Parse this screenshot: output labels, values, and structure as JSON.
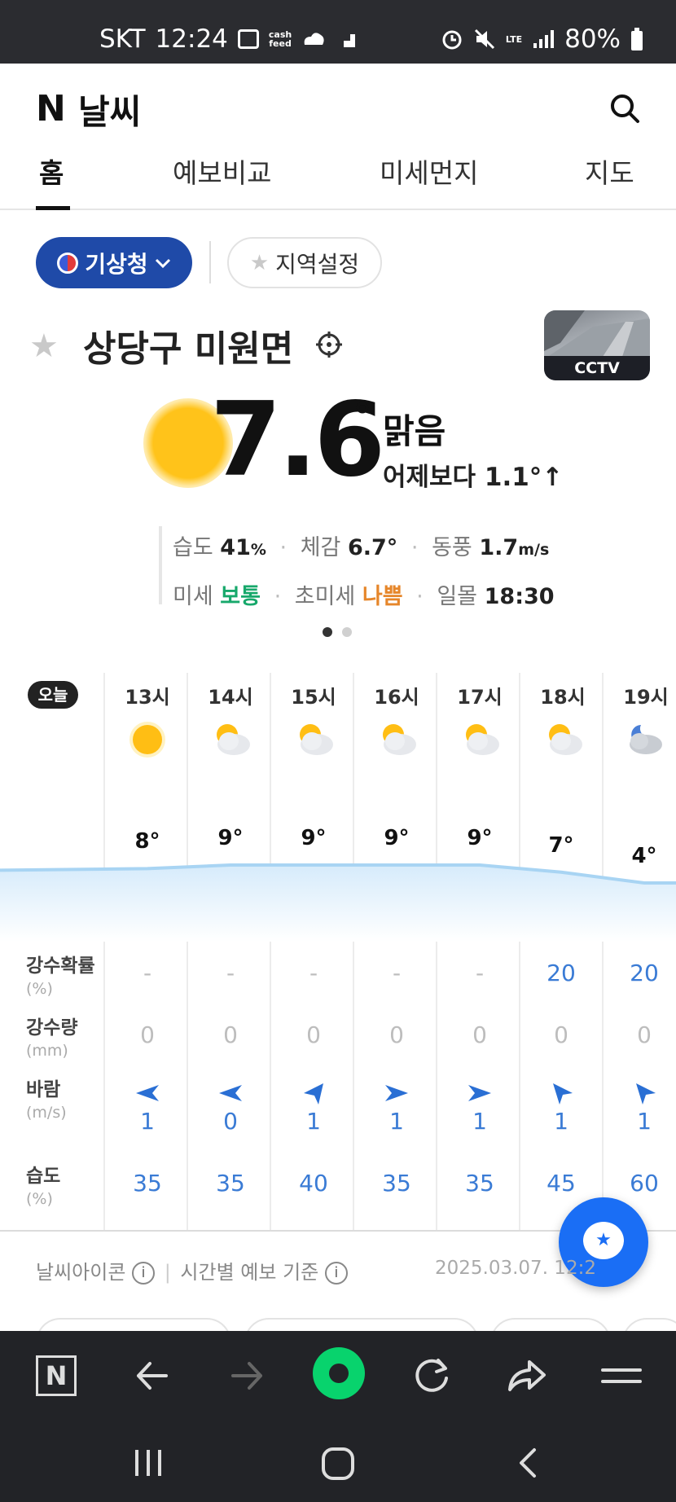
{
  "status_bar": {
    "carrier": "SKT",
    "time": "12:24",
    "cash_label_top": "cash",
    "cash_label_bottom": "feed",
    "network": "LTE",
    "battery": "80%"
  },
  "header": {
    "logo_n": "N",
    "title": "날씨",
    "tabs": [
      {
        "label": "홈",
        "active": true
      },
      {
        "label": "예보비교",
        "active": false
      },
      {
        "label": "미세먼지",
        "active": false
      },
      {
        "label": "지도",
        "active": false
      }
    ]
  },
  "source": {
    "provider": "기상청",
    "region_button": "지역설정"
  },
  "location": {
    "name": "상당구 미원면",
    "cctv_label": "CCTV"
  },
  "current": {
    "temperature": "7.6",
    "degree": "°",
    "condition": "맑음",
    "compare": "어제보다 1.1°↑",
    "humidity_label": "습도",
    "humidity_value": "41",
    "humidity_unit": "%",
    "feels_label": "체감",
    "feels_value": "6.7°",
    "wind_label": "동풍",
    "wind_value": "1.7",
    "wind_unit": "m/s",
    "fine_dust_label": "미세",
    "fine_dust_value": "보통",
    "ultra_dust_label": "초미세",
    "ultra_dust_value": "나쁨",
    "sunset_label": "일몰",
    "sunset_value": "18:30"
  },
  "hourly": {
    "today_label": "오늘",
    "hours": [
      {
        "time": "13시",
        "icon": "sun-icon",
        "temp": "8°",
        "precip_prob": "-",
        "precip": "0",
        "wind_dir": "west-arrow-icon",
        "wind": "1",
        "humidity": "35"
      },
      {
        "time": "14시",
        "icon": "partly-cloudy-icon",
        "temp": "9°",
        "precip_prob": "-",
        "precip": "0",
        "wind_dir": "west-arrow-icon",
        "wind": "0",
        "humidity": "35"
      },
      {
        "time": "15시",
        "icon": "partly-cloudy-icon",
        "temp": "9°",
        "precip_prob": "-",
        "precip": "0",
        "wind_dir": "northeast-arrow-icon",
        "wind": "1",
        "humidity": "40"
      },
      {
        "time": "16시",
        "icon": "partly-cloudy-icon",
        "temp": "9°",
        "precip_prob": "-",
        "precip": "0",
        "wind_dir": "east-arrow-icon",
        "wind": "1",
        "humidity": "35"
      },
      {
        "time": "17시",
        "icon": "partly-cloudy-icon",
        "temp": "9°",
        "precip_prob": "-",
        "precip": "0",
        "wind_dir": "east-arrow-icon",
        "wind": "1",
        "humidity": "35"
      },
      {
        "time": "18시",
        "icon": "partly-cloudy-icon",
        "temp": "7°",
        "precip_prob": "20",
        "precip": "0",
        "wind_dir": "northwest-arrow-icon",
        "wind": "1",
        "humidity": "45"
      },
      {
        "time": "19시",
        "icon": "cloudy-night-icon",
        "temp": "4°",
        "precip_prob": "20",
        "precip": "0",
        "wind_dir": "northwest-arrow-icon",
        "wind": "1",
        "humidity": "60"
      }
    ],
    "rows": {
      "precip_prob_label": "강수확률",
      "precip_prob_unit": "(%)",
      "precip_label": "강수량",
      "precip_unit": "(mm)",
      "wind_label": "바람",
      "wind_unit": "(m/s)",
      "humidity_label": "습도",
      "humidity_unit": "(%)"
    }
  },
  "footer_note": {
    "icon_label": "날씨아이콘",
    "basis_label": "시간별 예보 기준",
    "info_glyph": "i",
    "date": "2025.03.07. 12:2"
  },
  "toolbar": {
    "home_label": "N"
  },
  "colors": {
    "status_bg": "#2b2c30",
    "provider_pill": "#1f4aa8",
    "accent_blue": "#3a7bd5",
    "good": "#17a86b",
    "bad": "#e6862a",
    "fab": "#1a6ef5",
    "toolbar_bg": "#222327",
    "green_button": "#08d36d"
  }
}
